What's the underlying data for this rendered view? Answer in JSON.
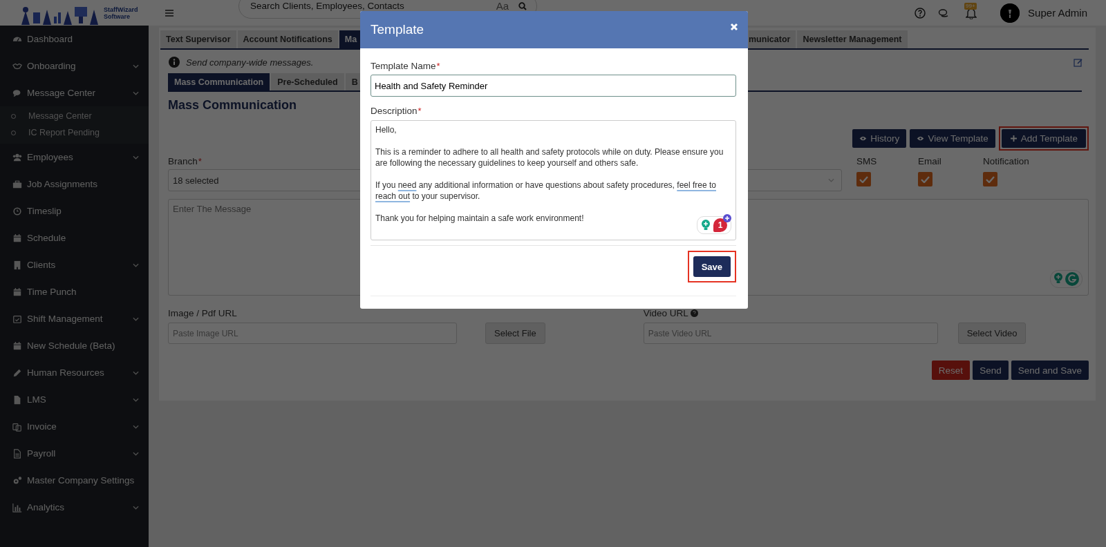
{
  "header": {
    "logo_text": [
      "StaffWizard",
      "Software"
    ],
    "search": {
      "placeholder": "Search Clients, Employees, Contacts",
      "hint": "Aa"
    },
    "notification_badge": "99+",
    "user": "Super Admin"
  },
  "sidebar": {
    "items": [
      {
        "label": "Dashboard",
        "has_menu": false,
        "expanded": false
      },
      {
        "label": "Onboarding",
        "has_menu": true,
        "expanded": false
      },
      {
        "label": "Message Center",
        "has_menu": true,
        "expanded": true,
        "children": [
          {
            "label": "Message Center"
          },
          {
            "label": "IC Report Pending"
          }
        ]
      },
      {
        "label": "Employees",
        "has_menu": true,
        "expanded": false
      },
      {
        "label": "Job Assignments",
        "has_menu": false,
        "expanded": false
      },
      {
        "label": "Timeslip",
        "has_menu": false,
        "expanded": false
      },
      {
        "label": "Schedule",
        "has_menu": false,
        "expanded": false
      },
      {
        "label": "Clients",
        "has_menu": true,
        "expanded": false
      },
      {
        "label": "Time Punch",
        "has_menu": false,
        "expanded": false
      },
      {
        "label": "Shift Management",
        "has_menu": true,
        "expanded": false
      },
      {
        "label": "New Schedule (Beta)",
        "has_menu": false,
        "expanded": false
      },
      {
        "label": "Human Resources",
        "has_menu": true,
        "expanded": false
      },
      {
        "label": "LMS",
        "has_menu": true,
        "expanded": false
      },
      {
        "label": "Invoice",
        "has_menu": true,
        "expanded": false
      },
      {
        "label": "Payroll",
        "has_menu": true,
        "expanded": false
      },
      {
        "label": "Master Company Settings",
        "has_menu": false,
        "expanded": false
      },
      {
        "label": "Analytics",
        "has_menu": true,
        "expanded": false
      }
    ]
  },
  "top_tabs": [
    {
      "label": "Text Supervisor",
      "selected": false
    },
    {
      "label": "Account Notifications",
      "selected": false
    },
    {
      "label": "Ma",
      "selected": true
    },
    {
      "label": "municator",
      "selected": false
    },
    {
      "label": "Newsletter Management",
      "selected": false
    }
  ],
  "info": "Send company-wide messages.",
  "sub_tabs": [
    {
      "label": "Mass Communication",
      "selected": true
    },
    {
      "label": "Pre-Scheduled",
      "selected": false
    },
    {
      "label": "B",
      "selected": false
    }
  ],
  "title": "Mass Communication",
  "actions": [
    {
      "label": "History",
      "highlighted": false
    },
    {
      "label": "View Template",
      "highlighted": false
    },
    {
      "label": "Add Template",
      "highlighted": true
    }
  ],
  "branch": {
    "label": "Branch",
    "required": true,
    "required_mark": "*",
    "value": "18 selected"
  },
  "channels": [
    {
      "label": "SMS",
      "checked": true
    },
    {
      "label": "Email",
      "checked": true
    },
    {
      "label": "Notification",
      "checked": true
    }
  ],
  "message": {
    "placeholder": "Enter The Message"
  },
  "image": {
    "label": "Image / Pdf URL",
    "placeholder": "Paste Image URL",
    "button": "Select File"
  },
  "video": {
    "label": "Video URL",
    "placeholder": "Paste Video URL",
    "button": "Select Video"
  },
  "form_buttons": [
    {
      "label": "Reset",
      "kind": "danger"
    },
    {
      "label": "Send",
      "kind": "primary"
    },
    {
      "label": "Send and Save",
      "kind": "primary"
    }
  ],
  "modal": {
    "title": "Template",
    "name_field": {
      "label": "Template Name",
      "required": true,
      "required_mark": "*",
      "value": "Health and Safety Reminder"
    },
    "description": {
      "label": "Description",
      "required": true,
      "required_mark": "*",
      "paragraphs": [
        [
          {
            "text": "Hello,",
            "underlined": false
          }
        ],
        [
          {
            "text": "This is a reminder to adhere to all health and safety protocols while on duty. Please ensure you are following the necessary guidelines to keep yourself and others safe.",
            "underlined": false
          }
        ],
        [
          {
            "text": "If you ",
            "underlined": false
          },
          {
            "text": "need",
            "underlined": true
          },
          {
            "text": " any additional information or have questions about safety procedures, ",
            "underlined": false
          },
          {
            "text": "feel free to reach out",
            "underlined": true
          },
          {
            "text": " to your supervisor.",
            "underlined": false
          }
        ],
        [
          {
            "text": "Thank you for helping maintain a safe work environment!",
            "underlined": false
          }
        ]
      ]
    },
    "grammar_count": "1",
    "save": {
      "label": "Save",
      "highlighted": true
    }
  }
}
